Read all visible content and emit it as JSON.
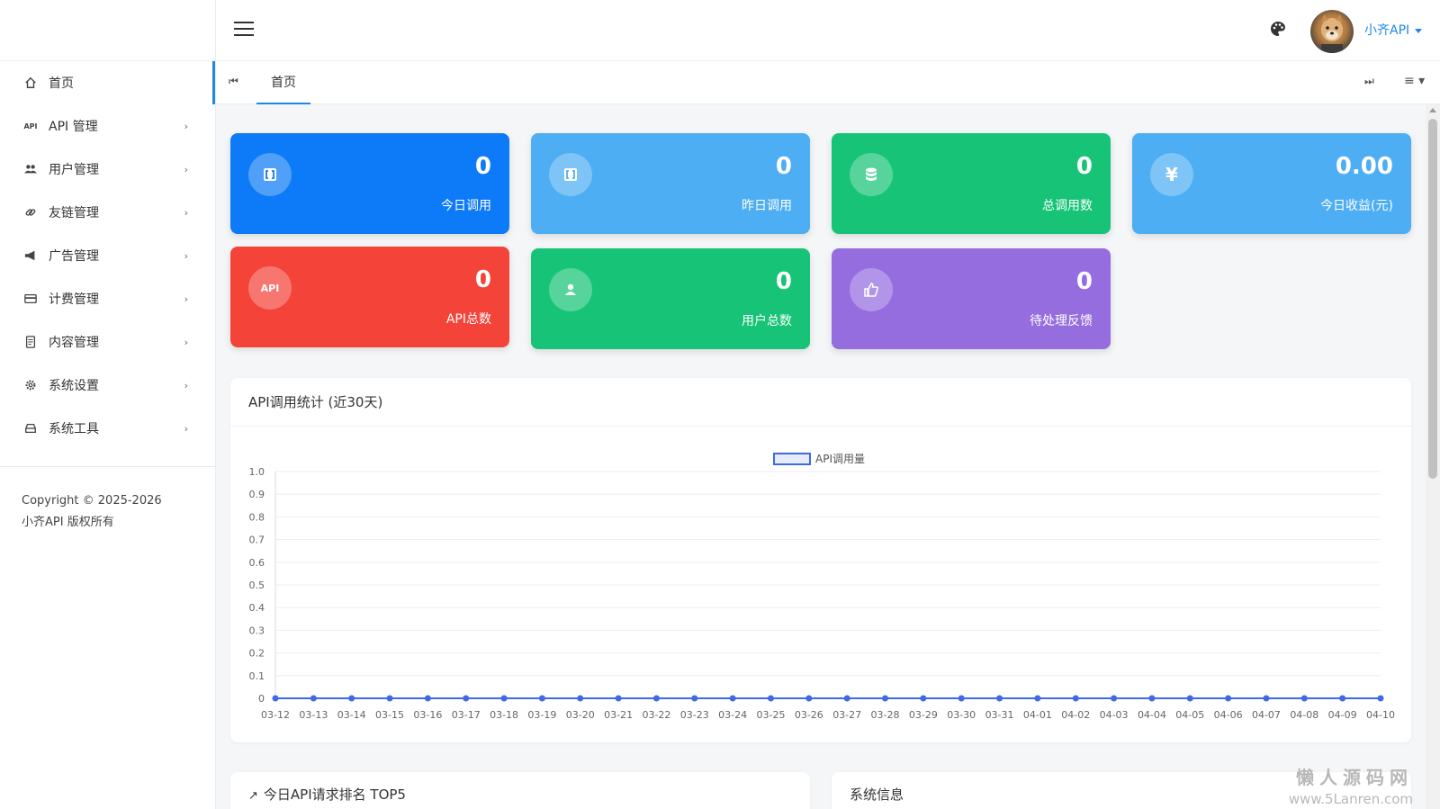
{
  "sidebar": {
    "items": [
      {
        "label": "首页",
        "icon": "home-icon"
      },
      {
        "label": "API 管理",
        "icon": "api-icon"
      },
      {
        "label": "用户管理",
        "icon": "users-icon"
      },
      {
        "label": "友链管理",
        "icon": "link-icon"
      },
      {
        "label": "广告管理",
        "icon": "megaphone-icon"
      },
      {
        "label": "计费管理",
        "icon": "credit-card-icon"
      },
      {
        "label": "内容管理",
        "icon": "document-icon"
      },
      {
        "label": "系统设置",
        "icon": "gear-icon"
      },
      {
        "label": "系统工具",
        "icon": "toolbox-icon"
      }
    ],
    "copyright": "Copyright © 2025-2026 小齐API 版权所有"
  },
  "header": {
    "username": "小齐API"
  },
  "tabs": {
    "home": "首页"
  },
  "stats": [
    {
      "value": "0",
      "label": "今日调用",
      "icon": "brackets-icon",
      "color": "#0d7af7"
    },
    {
      "value": "0",
      "label": "昨日调用",
      "icon": "brackets-icon",
      "color": "#4eaef3"
    },
    {
      "value": "0",
      "label": "总调用数",
      "icon": "database-icon",
      "color": "#17c477"
    },
    {
      "value": "0.00",
      "label": "今日收益(元)",
      "icon": "yen-icon",
      "color": "#4eaef3"
    },
    {
      "value": "0",
      "label": "API总数",
      "icon": "api-badge-icon",
      "color": "#f44339"
    },
    {
      "value": "0",
      "label": "用户总数",
      "icon": "user-icon",
      "color": "#17c477"
    },
    {
      "value": "0",
      "label": "待处理反馈",
      "icon": "thumbs-up-icon",
      "color": "#956ddf"
    }
  ],
  "chart_panel": {
    "title": "API调用统计 (近30天)"
  },
  "chart_data": {
    "type": "line",
    "title": "",
    "xlabel": "",
    "ylabel": "",
    "x": [
      "03-12",
      "03-13",
      "03-14",
      "03-15",
      "03-16",
      "03-17",
      "03-18",
      "03-19",
      "03-20",
      "03-21",
      "03-22",
      "03-23",
      "03-24",
      "03-25",
      "03-26",
      "03-27",
      "03-28",
      "03-29",
      "03-30",
      "03-31",
      "04-01",
      "04-02",
      "04-03",
      "04-04",
      "04-05",
      "04-06",
      "04-07",
      "04-08",
      "04-09",
      "04-10"
    ],
    "series": [
      {
        "name": "API调用量",
        "values": [
          0,
          0,
          0,
          0,
          0,
          0,
          0,
          0,
          0,
          0,
          0,
          0,
          0,
          0,
          0,
          0,
          0,
          0,
          0,
          0,
          0,
          0,
          0,
          0,
          0,
          0,
          0,
          0,
          0,
          0
        ],
        "color": "#4169e1"
      }
    ],
    "ylim": [
      0,
      1.0
    ],
    "yticks": [
      "1.0",
      "0.9",
      "0.8",
      "0.7",
      "0.6",
      "0.5",
      "0.4",
      "0.3",
      "0.2",
      "0.1",
      "0"
    ],
    "grid": true,
    "legend": "top-center"
  },
  "bottom": {
    "left_title": "今日API请求排名 TOP5",
    "right_title": "系统信息"
  },
  "watermark": {
    "line1": "懒人源码网",
    "line2": "www.5Lanren.com"
  }
}
